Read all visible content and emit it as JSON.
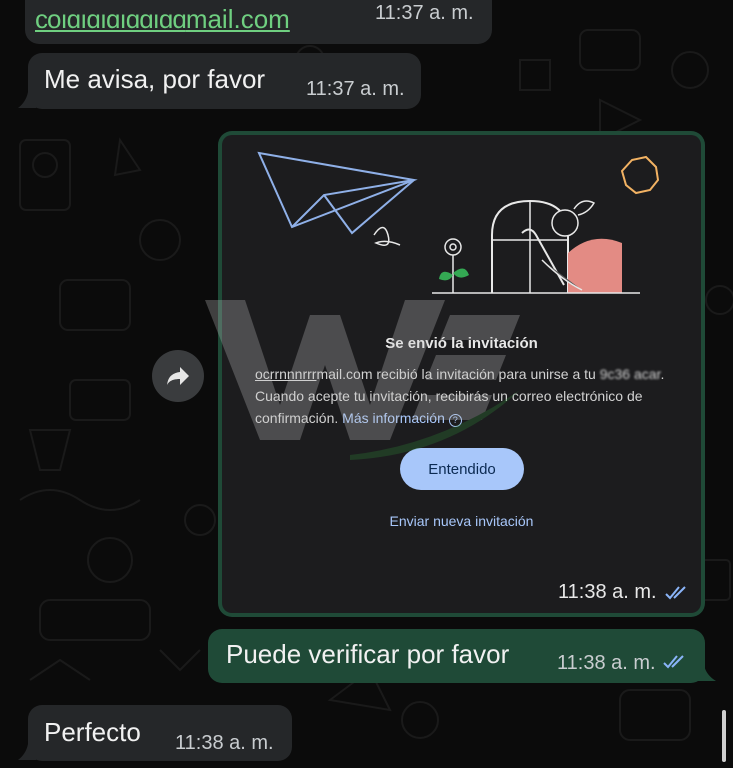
{
  "messages": [
    {
      "id": "email",
      "text": "coı̧aı̀ı́ı̦mail.com",
      "text_visible": "⁣mail.com",
      "time": "11:37 a. m."
    },
    {
      "id": "avisa",
      "text": "Me avisa, por favor",
      "time": "11:37 a. m."
    },
    {
      "id": "verificar",
      "text": "Puede verificar por favor",
      "time": "11:38 a. m."
    },
    {
      "id": "perfecto",
      "text": "Perfecto",
      "time": "11:38 a. m."
    }
  ],
  "card": {
    "title": "Se envió la invitación",
    "body_email": "mail.com",
    "body_main": " recibió la invitación para unirse a tu ",
    "body_cont": ". Cuando acepte tu invitación, recibirás un correo electrónico de confirmación. ",
    "link": "Más información",
    "primary_button": "Entendido",
    "secondary_link": "Enviar nueva invitación",
    "time": "11:38 a. m."
  },
  "colors": {
    "outgoing": "#1f4a37",
    "incoming": "#252729",
    "link": "#a8c7fa",
    "read_ticks": "#8ab4f8"
  },
  "icons": [
    "forward-icon",
    "double-check-icon",
    "info-icon",
    "paper-plane-icon"
  ]
}
